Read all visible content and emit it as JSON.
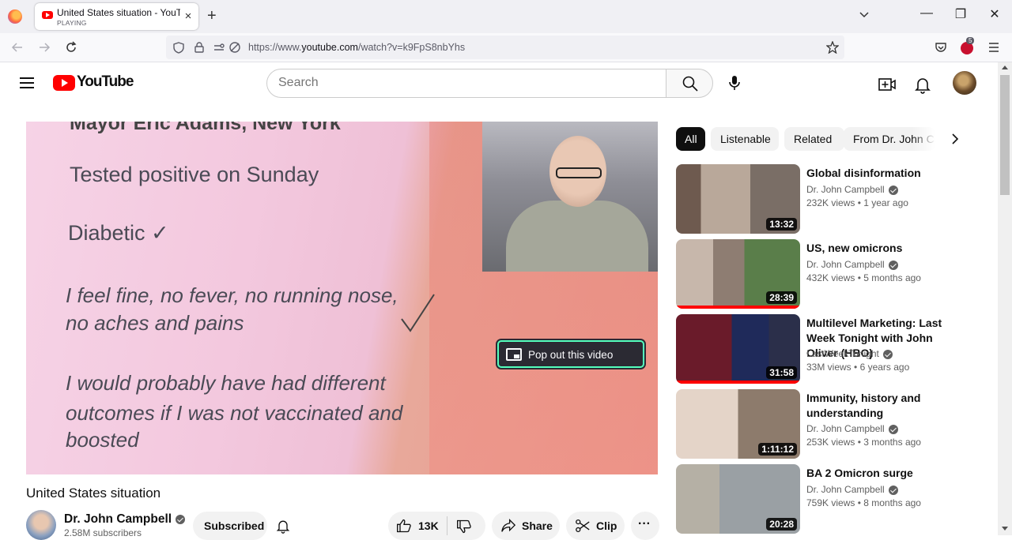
{
  "browser": {
    "tab": {
      "title": "United States situation - YouTube",
      "status": "PLAYING",
      "close": "×"
    },
    "new_tab": "+",
    "window": {
      "minimize": "—",
      "maximize": "❐",
      "close": "✕"
    },
    "url": {
      "prefix": "https://www.",
      "domain": "youtube.com",
      "path": "/watch?v=k9FpS8nbYhs"
    },
    "extension_badge": "5"
  },
  "header": {
    "logo_text": "YouTube",
    "search": {
      "placeholder": "Search",
      "value": ""
    }
  },
  "player": {
    "slide_lines": [
      "Mayor Eric Adams, New York",
      "Tested positive on Sunday",
      "Diabetic ✓",
      "I feel fine, no fever, no running nose,",
      "no aches and pains",
      "I would probably have had different",
      "outcomes if I was not vaccinated and",
      "boosted"
    ],
    "popout_label": "Pop out this video"
  },
  "video": {
    "title": "United States situation",
    "channel": "Dr. John Campbell",
    "subscribers": "2.58M subscribers",
    "subscribe_label": "Subscribed",
    "likes": "13K",
    "share_label": "Share",
    "clip_label": "Clip",
    "more": "···"
  },
  "chips": [
    "All",
    "Listenable",
    "Related",
    "From Dr. John Campbell"
  ],
  "related": [
    {
      "title": "Global disinformation",
      "channel": "Dr. John Campbell",
      "views": "232K views",
      "age": "1 year ago",
      "duration": "13:32",
      "progress": 0
    },
    {
      "title": "US, new omicrons",
      "channel": "Dr. John Campbell",
      "views": "432K views",
      "age": "5 months ago",
      "duration": "28:39",
      "progress": 100
    },
    {
      "title": "Multilevel Marketing: Last Week Tonight with John Oliver (HBO)",
      "channel": "LastWeekTonight",
      "views": "33M views",
      "age": "6 years ago",
      "duration": "31:58",
      "progress": 100
    },
    {
      "title": "Immunity, history and understanding",
      "channel": "Dr. John Campbell",
      "views": "253K views",
      "age": "3 months ago",
      "duration": "1:11:12",
      "progress": 0
    },
    {
      "title": "BA 2 Omicron surge",
      "channel": "Dr. John Campbell",
      "views": "759K views",
      "age": "8 months ago",
      "duration": "20:28",
      "progress": 0
    }
  ],
  "colors": {
    "accent": "#ff0000",
    "popout_border": "#54ffbd",
    "chip_active": "#0f0f0f"
  }
}
